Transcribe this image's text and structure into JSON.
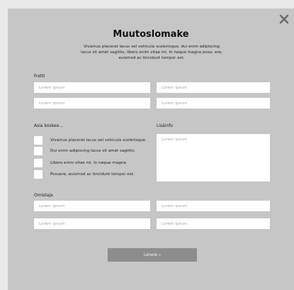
{
  "form": {
    "title": "Muutoslomake",
    "intro": "Vivamus placerat lacus vel vehicula scelerisque, dui enim adipiscing lacus sit amet sagittis, libero enim vitae mi. In neque magna posu- ere, euismod ac tincidunt tempor est."
  },
  "section_fretti": {
    "label": "Fretti",
    "fields": [
      "Lorem ipsum",
      "Lorem ipsum",
      "Lorem ipsum",
      "Lorem ipsum"
    ]
  },
  "section_asia": {
    "label": "Asia koskee...",
    "options": [
      "Vivamus placerat lacus vel vehicula scelerisque.",
      "Dui enim adipiscing lacus sit amet sagittis.",
      "Libero enim vitae mi. In neque magna",
      "Posuere, euismod ac tincidunt tempor est."
    ]
  },
  "section_lisainfo": {
    "label": "Lisäinfo",
    "placeholder": "Lorem ipsum"
  },
  "section_omistaja": {
    "label": "Omistaja",
    "fields": [
      "Lorem ipsum",
      "Lorem ipsum",
      "Lorem ipsum",
      "Lorem ipsum"
    ]
  },
  "submit_label": "Lähetä »",
  "icons": {
    "close": "close-icon"
  }
}
